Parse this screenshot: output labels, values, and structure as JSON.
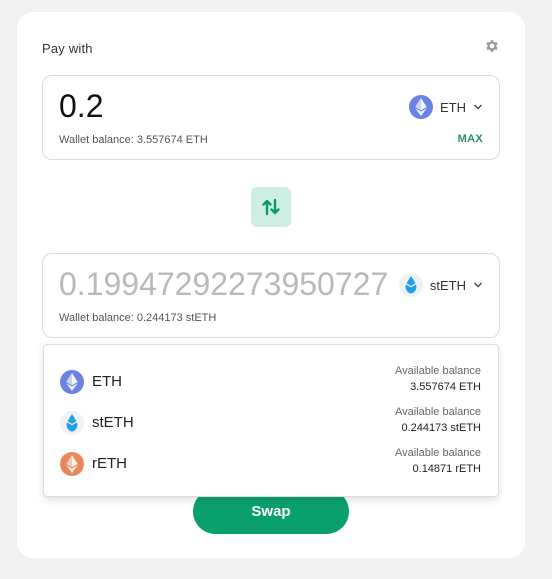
{
  "header": {
    "pay_label": "Pay with"
  },
  "pay": {
    "amount": "0.2",
    "token": "ETH",
    "wallet_balance": "Wallet balance: 3.557674 ETH",
    "max_label": "MAX"
  },
  "receive": {
    "amount": "0.199472922739507277",
    "token": "stETH",
    "wallet_balance": "Wallet balance: 0.244173 stETH"
  },
  "dropdown": {
    "options": [
      {
        "symbol": "ETH",
        "balance_label": "Available balance",
        "balance": "3.557674 ETH",
        "icon": "eth-icon"
      },
      {
        "symbol": "stETH",
        "balance_label": "Available balance",
        "balance": "0.244173 stETH",
        "icon": "steth-icon"
      },
      {
        "symbol": "rETH",
        "balance_label": "Available balance",
        "balance": "0.14871 rETH",
        "icon": "reth-icon"
      }
    ]
  },
  "swap_button": {
    "label": "Swap"
  },
  "colors": {
    "accent": "#0aa06e",
    "max": "#2c8c73",
    "swap_dir_bg": "#cfeee3"
  }
}
